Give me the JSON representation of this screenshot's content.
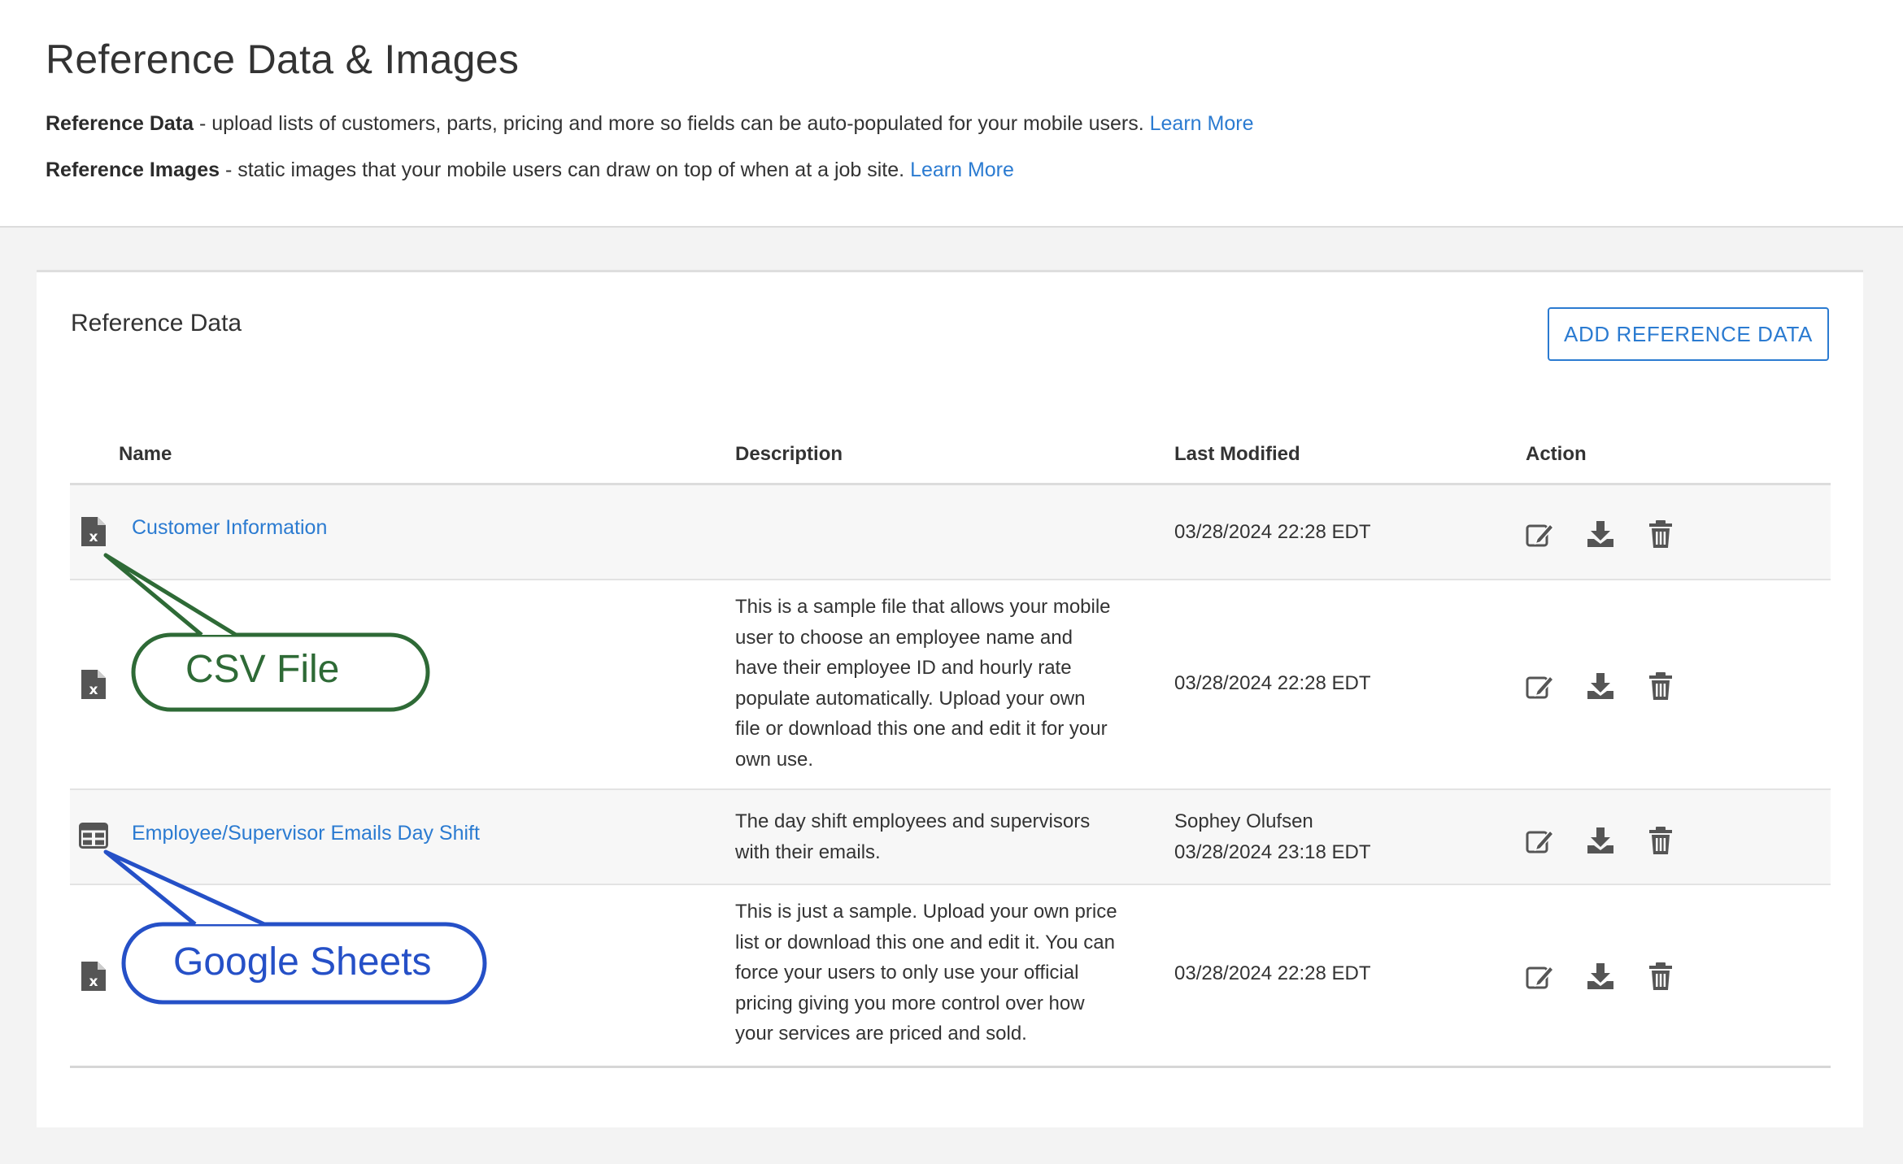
{
  "header": {
    "title": "Reference Data & Images",
    "intro": [
      {
        "term": "Reference Data",
        "text": " - upload lists of customers, parts, pricing and more so fields can be auto-populated for your mobile users. ",
        "link": "Learn More"
      },
      {
        "term": "Reference Images",
        "text": " - static images that your mobile users can draw on top of when at a job site. ",
        "link": "Learn More"
      }
    ]
  },
  "card": {
    "title": "Reference Data",
    "add_button": "ADD REFERENCE DATA",
    "columns": {
      "name": "Name",
      "description": "Description",
      "last_modified": "Last Modified",
      "action": "Action"
    },
    "rows": [
      {
        "icon": "excel-file-icon",
        "name": "Customer Information",
        "description": [],
        "modified_by": "",
        "modified": "03/28/2024 22:28 EDT"
      },
      {
        "icon": "excel-file-icon",
        "name": "",
        "description": [
          "This is a sample file that allows your mobile",
          "user to choose an employee name and",
          "have their employee ID and hourly rate",
          "populate automatically. Upload your own",
          "file or download this one and edit it for your",
          "own use."
        ],
        "modified_by": "",
        "modified": "03/28/2024 22:28 EDT"
      },
      {
        "icon": "google-sheets-icon",
        "name": "Employee/Supervisor Emails Day Shift",
        "description": [
          "The day shift employees and supervisors",
          "with their emails."
        ],
        "modified_by": "Sophey Olufsen",
        "modified": "03/28/2024 23:18 EDT"
      },
      {
        "icon": "excel-file-icon",
        "name": "",
        "description": [
          "This is just a sample. Upload your own price",
          "list or download this one and edit it. You can",
          "force your users to only use your official",
          "pricing giving you more control over how",
          "your services are priced and sold."
        ],
        "modified_by": "",
        "modified": "03/28/2024 22:28 EDT"
      }
    ],
    "action_icons": [
      "edit-icon",
      "download-icon",
      "trash-icon"
    ]
  },
  "callouts": {
    "csv": {
      "label": "CSV File",
      "color": "#2e6a36"
    },
    "sheets": {
      "label": "Google Sheets",
      "color": "#2550c7"
    }
  },
  "colors": {
    "link": "#2b7bd1",
    "icon": "#555555",
    "background": "#f3f3f3"
  }
}
